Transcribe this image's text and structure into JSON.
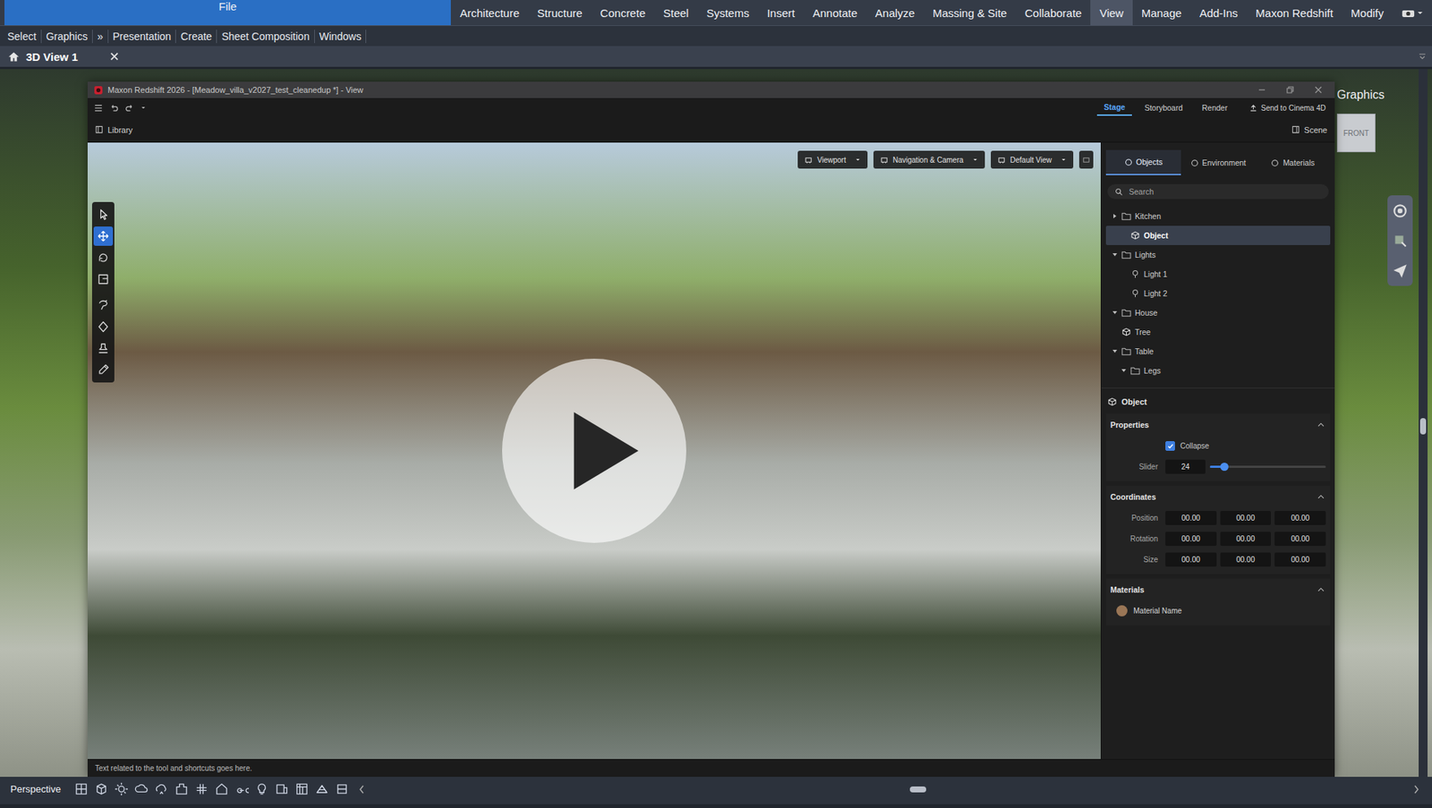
{
  "ribbon_tabs": [
    {
      "label": "File",
      "selected": false,
      "kind": "application"
    },
    {
      "label": "Architecture",
      "selected": false,
      "kind": "tab"
    },
    {
      "label": "Structure",
      "selected": false,
      "kind": "tab"
    },
    {
      "label": "Concrete",
      "selected": false,
      "kind": "tab"
    },
    {
      "label": "Steel",
      "selected": false,
      "kind": "tab"
    },
    {
      "label": "Systems",
      "selected": false,
      "kind": "tab"
    },
    {
      "label": "Insert",
      "selected": false,
      "kind": "tab"
    },
    {
      "label": "Annotate",
      "selected": false,
      "kind": "tab"
    },
    {
      "label": "Analyze",
      "selected": false,
      "kind": "tab"
    },
    {
      "label": "Massing & Site",
      "selected": false,
      "kind": "tab"
    },
    {
      "label": "Collaborate",
      "selected": false,
      "kind": "tab"
    },
    {
      "label": "View",
      "selected": true,
      "kind": "tab"
    },
    {
      "label": "Manage",
      "selected": false,
      "kind": "tab"
    },
    {
      "label": "Add-Ins",
      "selected": false,
      "kind": "tab"
    },
    {
      "label": "Maxon Redshift",
      "selected": false,
      "kind": "tab"
    },
    {
      "label": "Modify",
      "selected": false,
      "kind": "tab"
    }
  ],
  "panel_bar": [
    "Select",
    "Graphics",
    "»",
    "Presentation",
    "Create",
    "Sheet Composition",
    "Windows"
  ],
  "view_tab": {
    "label": "3D View 1"
  },
  "background_view": {
    "panel_title": "Graphics",
    "viewcube_face": "FRONT"
  },
  "status_bar": {
    "view_mode": "Perspective"
  },
  "redshift": {
    "title": "Maxon Redshift 2026 - [Meadow_villa_v2027_test_cleanedup *] - View",
    "mode_tabs": [
      {
        "label": "Stage",
        "selected": true
      },
      {
        "label": "Storyboard",
        "selected": false
      },
      {
        "label": "Render",
        "selected": false
      }
    ],
    "send_button": "Send to Cinema 4D",
    "library_button": "Library",
    "scene_button": "Scene",
    "viewport_menus": [
      "Viewport",
      "Navigation & Camera",
      "Default View"
    ],
    "tools": [
      {
        "selected": false
      },
      {
        "selected": true
      },
      {
        "selected": false
      },
      {
        "selected": false
      },
      {
        "selected": false
      },
      {
        "selected": false
      },
      {
        "selected": false
      },
      {
        "selected": false
      }
    ],
    "panel_tabs": [
      {
        "label": "Objects",
        "selected": true
      },
      {
        "label": "Environment",
        "selected": false
      },
      {
        "label": "Materials",
        "selected": false
      }
    ],
    "search": {
      "placeholder": "Search"
    },
    "tree": [
      {
        "label": "Kitchen",
        "kind": "folder",
        "depth": 0,
        "expanded": false,
        "selected": false
      },
      {
        "label": "Object",
        "kind": "object",
        "depth": 1,
        "expanded": false,
        "selected": true
      },
      {
        "label": "Lights",
        "kind": "folder",
        "depth": 0,
        "expanded": true,
        "selected": false
      },
      {
        "label": "Light 1",
        "kind": "light",
        "depth": 1,
        "expanded": false,
        "selected": false
      },
      {
        "label": "Light 2",
        "kind": "light",
        "depth": 1,
        "expanded": false,
        "selected": false
      },
      {
        "label": "House",
        "kind": "folder",
        "depth": 0,
        "expanded": true,
        "selected": false
      },
      {
        "label": "Tree",
        "kind": "object",
        "depth": 0,
        "expanded": false,
        "selected": false
      },
      {
        "label": "Table",
        "kind": "folder",
        "depth": 0,
        "expanded": true,
        "selected": false
      },
      {
        "label": "Legs",
        "kind": "folder",
        "depth": 1,
        "expanded": true,
        "selected": false
      }
    ],
    "inspector": {
      "title": "Object",
      "properties": {
        "title": "Properties",
        "expanded": true,
        "checkbox": {
          "label": "Collapse",
          "checked": true
        },
        "slider": {
          "label": "Slider",
          "value": "24",
          "level": 0.12
        }
      },
      "coordinates": {
        "title": "Coordinates",
        "expanded": true,
        "rows": [
          {
            "label": "Position",
            "values": [
              "00.00",
              "00.00",
              "00.00"
            ]
          },
          {
            "label": "Rotation",
            "values": [
              "00.00",
              "00.00",
              "00.00"
            ]
          },
          {
            "label": "Size",
            "values": [
              "00.00",
              "00.00",
              "00.00"
            ]
          }
        ]
      },
      "materials": {
        "title": "Materials",
        "expanded": true,
        "items": [
          {
            "name": "Material Name",
            "color": "#9a7656"
          }
        ]
      }
    },
    "status_text": "Text related to the tool and shortcuts goes here."
  }
}
